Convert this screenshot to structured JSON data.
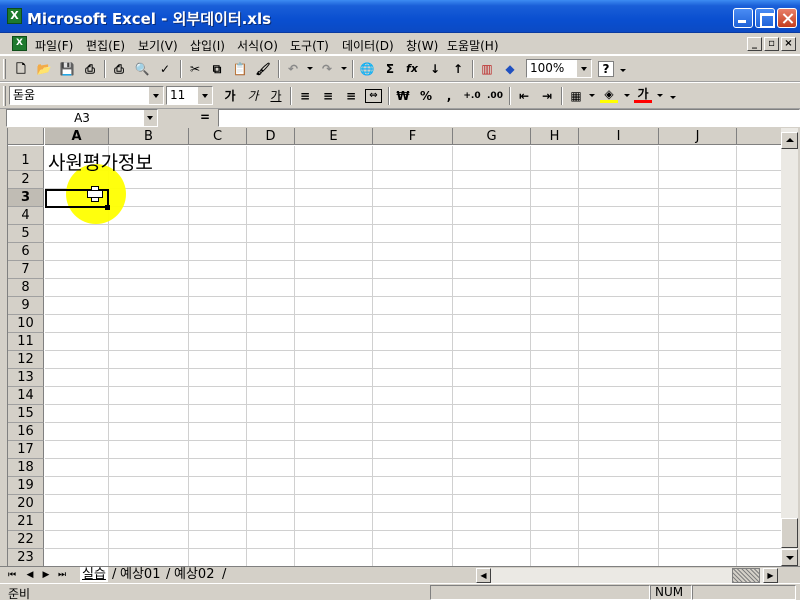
{
  "window": {
    "title": "Microsoft Excel - 외부데이터.xls",
    "app_icon_glyph": "X"
  },
  "menu": {
    "items": [
      "파일(F)",
      "편집(E)",
      "보기(V)",
      "삽입(I)",
      "서식(O)",
      "도구(T)",
      "데이터(D)",
      "창(W)",
      "도움말(H)"
    ]
  },
  "standard_toolbar": {
    "zoom": "100%",
    "help_glyph": "?",
    "autosum_glyph": "Σ",
    "function_glyph": "fx"
  },
  "format_toolbar": {
    "font_name": "돋움",
    "font_size": "11",
    "bold_label": "가",
    "italic_label": "가",
    "underline_label": "가",
    "currency_label": "₩",
    "percent_label": "%",
    "comma_label": ",",
    "font_color_label": "가"
  },
  "formula_bar": {
    "name_box": "A3",
    "equals": "=",
    "formula": ""
  },
  "columns": [
    "A",
    "B",
    "C",
    "D",
    "E",
    "F",
    "G",
    "H",
    "I",
    "J"
  ],
  "active_column": "A",
  "rows": [
    "1",
    "2",
    "3",
    "4",
    "5",
    "6",
    "7",
    "8",
    "9",
    "10",
    "11",
    "12",
    "13",
    "14",
    "15",
    "16",
    "17",
    "18",
    "19",
    "20",
    "21",
    "22",
    "23"
  ],
  "active_row": "3",
  "cells": {
    "A1": "사원평가정보"
  },
  "sheet_tabs": [
    "실습",
    "예상01",
    "예상02"
  ],
  "active_sheet": "실습",
  "status": {
    "text": "준비",
    "num_lock": "NUM"
  },
  "colors": {
    "title_bar": "#0a4fd0",
    "highlight": "#ffff00",
    "chrome": "#d4d0c8"
  }
}
